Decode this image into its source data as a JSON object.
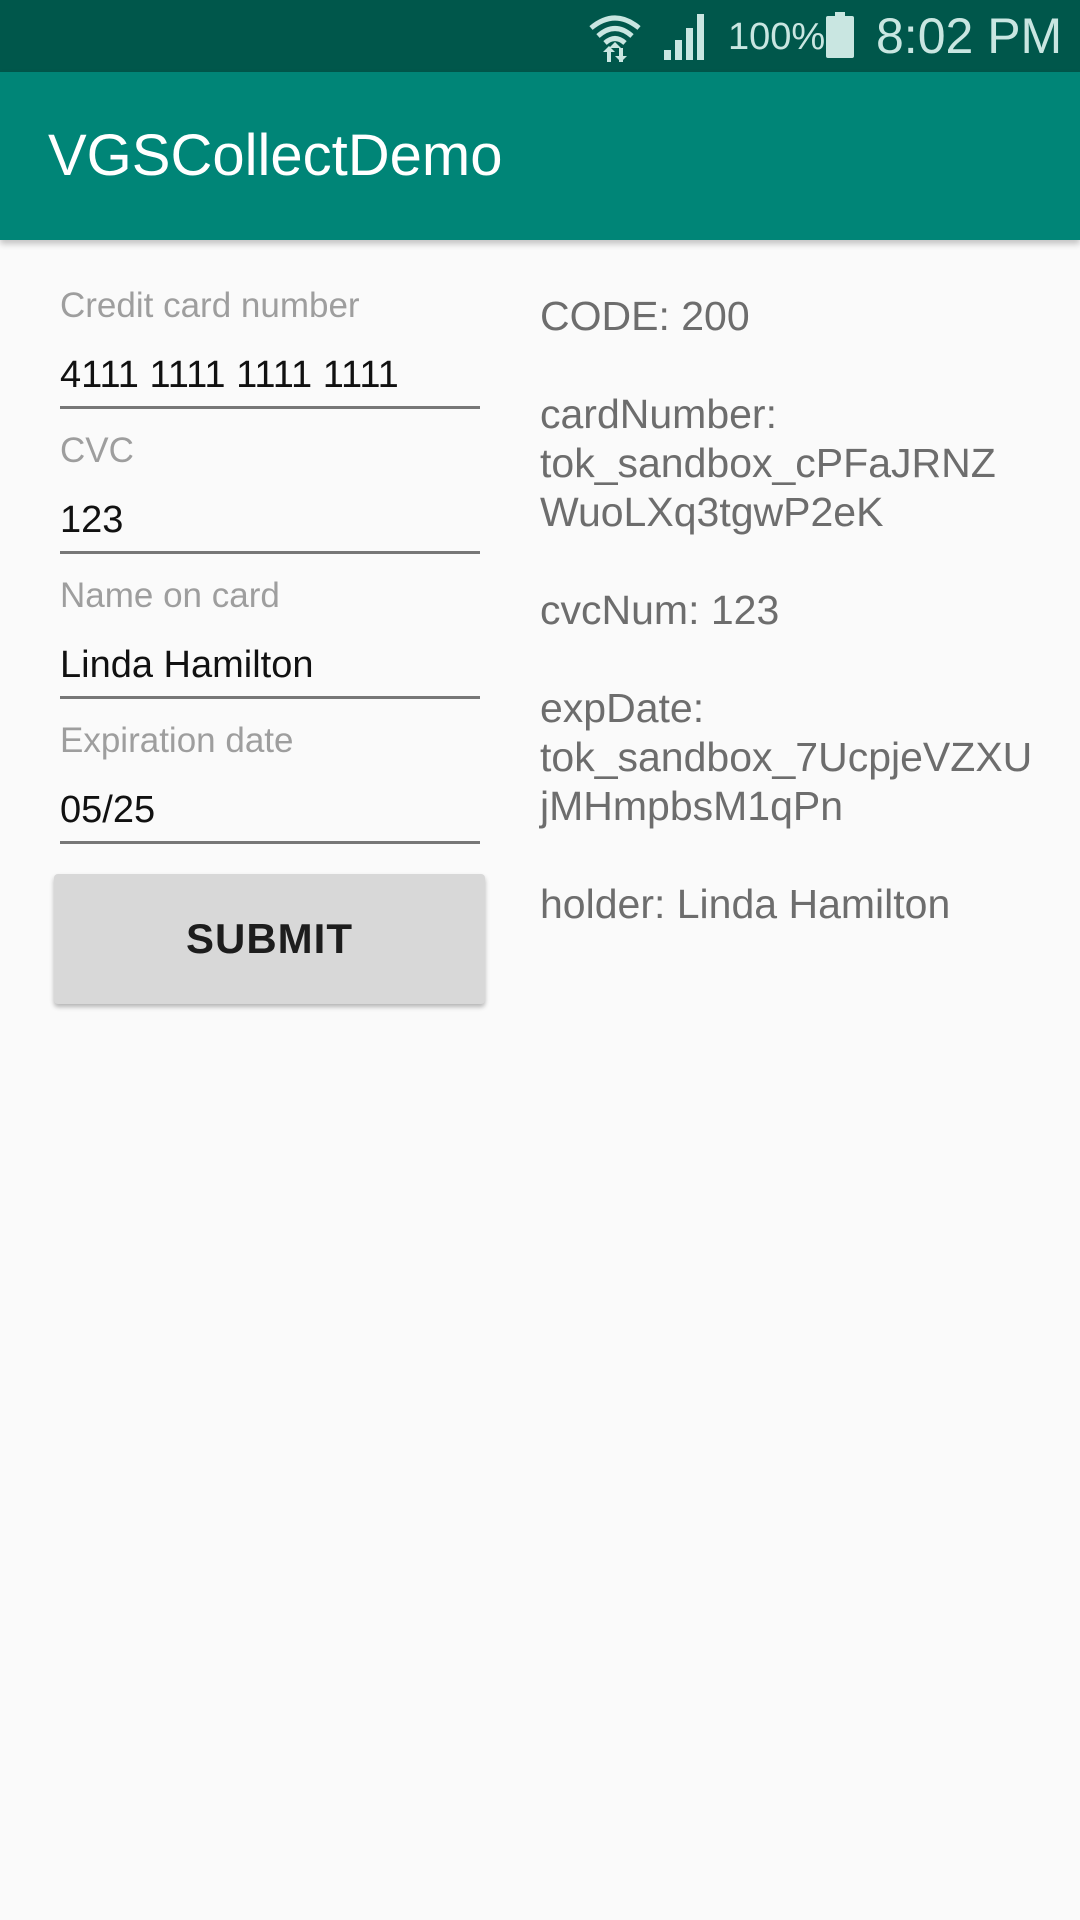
{
  "status_bar": {
    "battery_percent": "100%",
    "time": "8:02 PM",
    "icons": [
      "wifi-icon",
      "signal-icon",
      "battery-icon"
    ]
  },
  "app_bar": {
    "title": "VGSCollectDemo",
    "color": "#008577"
  },
  "form": {
    "fields": [
      {
        "label": "Credit card number",
        "value": "4111 1111 1111 1111"
      },
      {
        "label": "CVC",
        "value": "123"
      },
      {
        "label": "Name on card",
        "value": "Linda Hamilton"
      },
      {
        "label": "Expiration date",
        "value": "05/25"
      }
    ],
    "submit_label": "SUBMIT"
  },
  "response": {
    "code": "CODE: 200",
    "card_number_key": "cardNumber:",
    "card_number_line1": "tok_sandbox_cPFaJRNZ",
    "card_number_line2": "WuoLXq3tgwP2eK",
    "cvc": "cvcNum: 123",
    "exp_date_key": "expDate:",
    "exp_date_line1": "tok_sandbox_7UcpjeVZXU",
    "exp_date_line2": "jMHmpbsM1qPn",
    "holder": "holder: Linda Hamilton"
  }
}
